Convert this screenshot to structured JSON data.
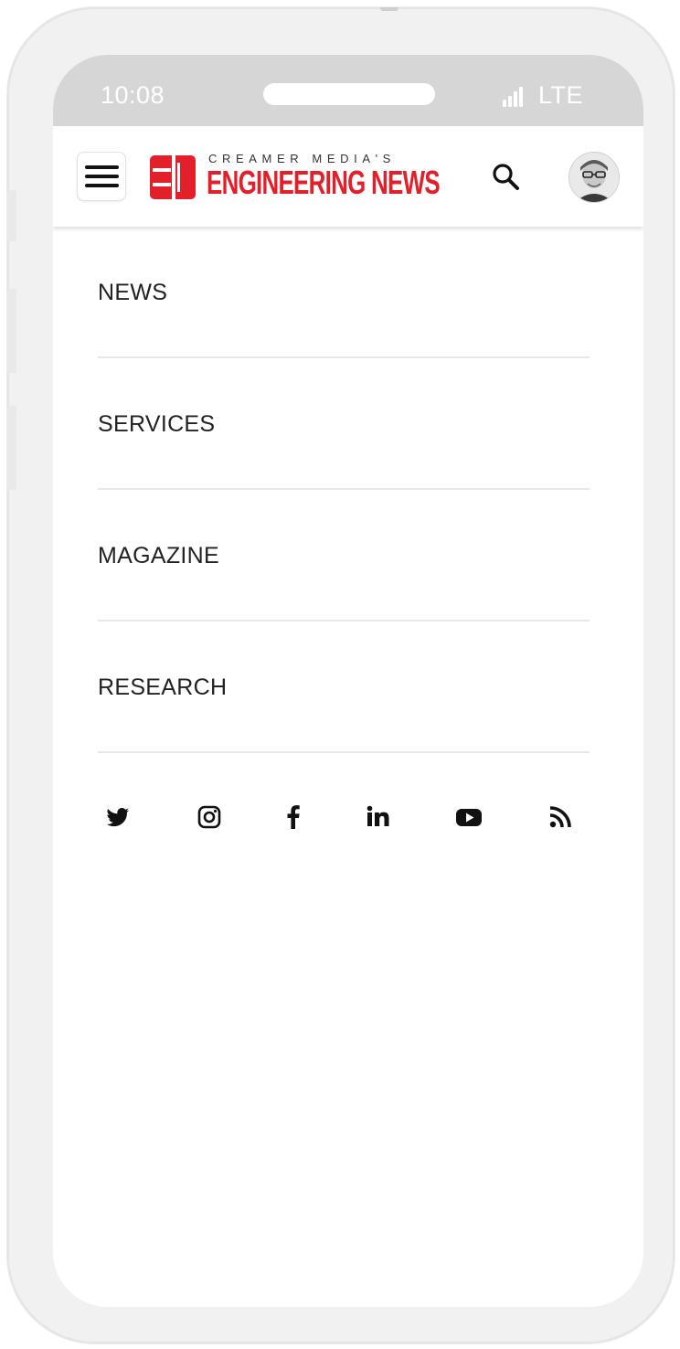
{
  "status_bar": {
    "time": "10:08",
    "network": "LTE"
  },
  "header": {
    "logo_top": "CREAMER MEDIA'S",
    "logo_main": "ENGINEERING NEWS",
    "menu_icon": "hamburger-icon",
    "search_icon": "search-icon",
    "avatar_icon": "user-avatar"
  },
  "menu": {
    "items": [
      {
        "label": "NEWS"
      },
      {
        "label": "SERVICES"
      },
      {
        "label": "MAGAZINE"
      },
      {
        "label": "RESEARCH"
      }
    ]
  },
  "social": {
    "icons": [
      "twitter-icon",
      "instagram-icon",
      "facebook-icon",
      "linkedin-icon",
      "youtube-icon",
      "rss-icon"
    ]
  },
  "colors": {
    "brand_red": "#e3202a",
    "status_bar": "#d6d6d6",
    "divider": "#e8e8e8",
    "text": "#222222"
  }
}
